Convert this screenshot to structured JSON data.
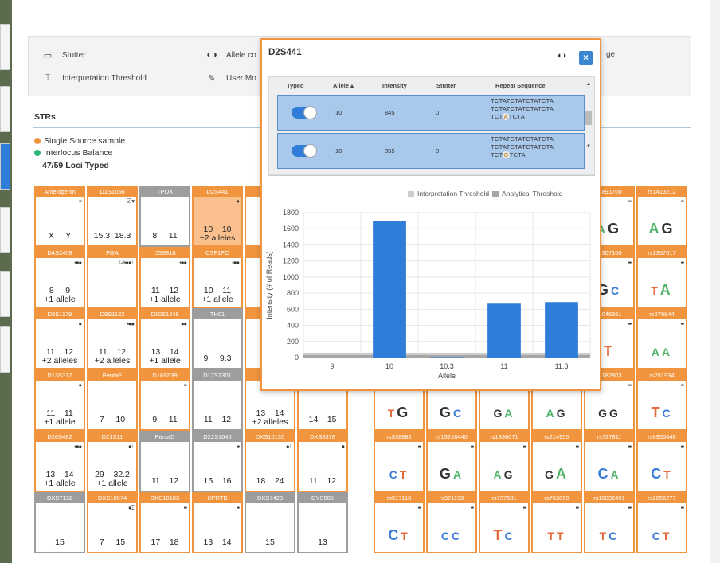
{
  "legend": {
    "stutter": "Stutter",
    "allele_cov_partial": "Allele co",
    "interp_threshold": "Interpretation Threshold",
    "user_mod_partial": "User Mo",
    "right_partial": "ge",
    "icons": {
      "stutter": "stutter-icon",
      "allele": "allele-coverage-icon",
      "threshold": "threshold-icon",
      "user": "user-modified-icon"
    }
  },
  "strs": {
    "title": "STRs",
    "single_source": "Single Source sample",
    "interlocus": "Interlocus Balance",
    "loci_typed": "47/59 Loci Typed",
    "colors": {
      "single_source": "#f0953e",
      "interlocus": "#2bb673"
    }
  },
  "cells": [
    {
      "name": "Amelogenin",
      "v": "X     Y",
      "ic": "•▪",
      "g": false
    },
    {
      "name": "D1S1656",
      "v": "15.3  18.3",
      "ic": "☑ ▾",
      "g": false
    },
    {
      "name": "TPOX",
      "v": "8     11",
      "ic": "",
      "g": true
    },
    {
      "name": "D2S441",
      "v": "10    10\n+2 alleles",
      "ic": "●",
      "g": false,
      "sel": true
    },
    {
      "name": "D4S2408",
      "v": "8     9\n+1 allele",
      "ic": "▪●●",
      "g": false
    },
    {
      "name": "FGA",
      "v": "",
      "ic": "☑▪●●⌶",
      "g": false
    },
    {
      "name": "D5S818",
      "v": "11    12\n+1 allele",
      "ic": "▪●●",
      "g": false
    },
    {
      "name": "CSF1PO",
      "v": "10    11\n+1 allele",
      "ic": "▪●●",
      "g": false
    },
    {
      "name": "D8S1179",
      "v": "11    12\n+2 alleles",
      "ic": "●",
      "g": false
    },
    {
      "name": "D9S1122",
      "v": "11    12\n+2 alleles",
      "ic": "▪●●",
      "g": false
    },
    {
      "name": "D10S1248",
      "v": "13    14\n+1 allele",
      "ic": "●●",
      "g": false
    },
    {
      "name": "TH01",
      "v": "9     9.3",
      "ic": "",
      "g": true
    },
    {
      "name": "D13S317",
      "v": "11    11\n+1 allele",
      "ic": "●",
      "g": false
    },
    {
      "name": "PentaE",
      "v": "7     10",
      "ic": "",
      "g": false
    },
    {
      "name": "D16S539",
      "v": "9     11",
      "ic": "▪▪",
      "g": false
    },
    {
      "name": "D17S1301",
      "v": "11    12",
      "ic": "",
      "g": true
    },
    {
      "name": "D20S482",
      "v": "13    14\n+1 allele",
      "ic": "▪●●",
      "g": false
    },
    {
      "name": "D21S11",
      "v": "29    32.2\n+1 allele",
      "ic": "●⌶",
      "g": false
    },
    {
      "name": "PentaD",
      "v": "11    12",
      "ic": "",
      "g": true
    },
    {
      "name": "D22S1045",
      "v": "15    16",
      "ic": "▪▪",
      "g": true
    },
    {
      "name": "DXS7132",
      "v": "15",
      "ic": "",
      "g": true
    },
    {
      "name": "DXS10074",
      "v": "7     15",
      "ic": "●⌶",
      "g": false
    },
    {
      "name": "DXS10103",
      "v": "17    18",
      "ic": "▪▪",
      "g": false
    },
    {
      "name": "HPRTB",
      "v": "13    14",
      "ic": "▪▪",
      "g": false
    }
  ],
  "cells_col5": [
    {
      "name": "D",
      "v": "10\n+2",
      "ic": "",
      "g": false
    },
    {
      "name": "D",
      "v": "1",
      "ic": "",
      "g": false
    },
    {
      "name": "",
      "v": "1\n+",
      "ic": "▪●",
      "g": false
    },
    {
      "name": "D",
      "v": "13    14\n+2 alleles",
      "ic": "",
      "g": false
    },
    {
      "name": "DXS10135",
      "v": "18    24",
      "ic": "●⌶",
      "g": false
    },
    {
      "name": "DXS7423",
      "v": "15",
      "ic": "",
      "g": true
    }
  ],
  "cells_col6": [
    {
      "name": "",
      "v": "14    15",
      "ic": "",
      "g": false
    },
    {
      "name": "DXS8378",
      "v": "11    12",
      "ic": "●",
      "g": false
    },
    {
      "name": "DYS505",
      "v": "13",
      "ic": "",
      "g": true
    }
  ],
  "snps": {
    "row0": [
      {
        "name": "rs891700",
        "bases": [
          [
            "A",
            "sm"
          ],
          [
            "G",
            ""
          ]
        ],
        "partial": true
      },
      {
        "name": "rs1413212",
        "bases": [
          [
            "A",
            ""
          ],
          [
            "G",
            ""
          ]
        ]
      }
    ],
    "row1": [
      {
        "name": "rs907100",
        "bases": [
          [
            "G",
            ""
          ],
          [
            "C",
            "sm"
          ]
        ],
        "partial": true
      },
      {
        "name": "rs1357617",
        "bases": [
          [
            "T",
            "sm"
          ],
          [
            "A",
            ""
          ]
        ]
      }
    ],
    "row2": [
      {
        "name": "rs046361",
        "bases": [
          [
            "T",
            ""
          ]
        ],
        "partial": true
      },
      {
        "name": "rs279844",
        "bases": [
          [
            "A",
            "sm"
          ],
          [
            "A",
            "sm"
          ]
        ]
      }
    ],
    "row3": [
      {
        "name": "",
        "bases": [
          [
            "T",
            "sm"
          ],
          [
            "G",
            ""
          ]
        ]
      },
      {
        "name": "",
        "bases": [
          [
            "G",
            ""
          ],
          [
            "C",
            "sm"
          ]
        ]
      },
      {
        "name": "",
        "bases": [
          [
            "G",
            "sm"
          ],
          [
            "A",
            "sm"
          ]
        ]
      },
      {
        "name": "",
        "bases": [
          [
            "A",
            "sm"
          ],
          [
            "G",
            "sm"
          ]
        ]
      },
      {
        "name": "rs182803",
        "bases": [
          [
            "G",
            "sm"
          ],
          [
            "G",
            "sm"
          ]
        ]
      },
      {
        "name": "rs251934",
        "bases": [
          [
            "T",
            ""
          ],
          [
            "C",
            "sm"
          ]
        ]
      }
    ],
    "row4": [
      {
        "name": "rs338882",
        "bases": [
          [
            "C",
            "sm"
          ],
          [
            "T",
            "sm"
          ]
        ]
      },
      {
        "name": "rs13218440",
        "bases": [
          [
            "G",
            ""
          ],
          [
            "A",
            "sm"
          ]
        ]
      },
      {
        "name": "rs1336071",
        "bases": [
          [
            "A",
            "sm"
          ],
          [
            "G",
            "sm"
          ]
        ]
      },
      {
        "name": "rs214955",
        "bases": [
          [
            "G",
            "sm"
          ],
          [
            "A",
            ""
          ]
        ]
      },
      {
        "name": "rs727811",
        "bases": [
          [
            "C",
            ""
          ],
          [
            "A",
            "sm"
          ]
        ]
      },
      {
        "name": "rs6955448",
        "bases": [
          [
            "C",
            ""
          ],
          [
            "T",
            "sm"
          ]
        ]
      }
    ],
    "row5": [
      {
        "name": "rs917118",
        "bases": [
          [
            "C",
            ""
          ],
          [
            "T",
            "sm"
          ]
        ]
      },
      {
        "name": "rs321198",
        "bases": [
          [
            "C",
            "sm"
          ],
          [
            "C",
            "sm"
          ]
        ]
      },
      {
        "name": "rs737681",
        "bases": [
          [
            "T",
            ""
          ],
          [
            "C",
            "sm"
          ]
        ]
      },
      {
        "name": "rs763869",
        "bases": [
          [
            "T",
            "sm"
          ],
          [
            "T",
            "sm"
          ]
        ]
      },
      {
        "name": "rs10092491",
        "bases": [
          [
            "T",
            "sm"
          ],
          [
            "C",
            "sm"
          ]
        ]
      },
      {
        "name": "rs2056277",
        "bases": [
          [
            "C",
            "sm"
          ],
          [
            "T",
            "sm"
          ]
        ]
      }
    ]
  },
  "popup": {
    "title": "D2S441",
    "close": "×",
    "headers": {
      "typed": "Typed",
      "allele": "Allele ▴",
      "intensity": "Intensity",
      "stutter": "Stutter",
      "repeat": "Repeat Sequence"
    },
    "rows": [
      {
        "allele": "10",
        "intensity": "845",
        "stutter": "0",
        "seq1": "TCTATCTATCTATCTA",
        "seq2": "TCTATCTATCTATCTA",
        "seq3a": "TCT",
        "seq3m": "A",
        "seq3b": "TCTA"
      },
      {
        "allele": "10",
        "intensity": "855",
        "stutter": "0",
        "seq1": "TCTATCTATCTATCTA",
        "seq2": "TCTATCTATCTATCTA",
        "seq3a": "TCT",
        "seq3m": "G",
        "seq3b": "TCTA"
      }
    ],
    "chart_legend": {
      "interp": "Interpretation Threshold",
      "analytical": "Analytical Threshold"
    }
  },
  "chart_data": {
    "type": "bar",
    "categories": [
      "9",
      "10",
      "10.3",
      "11",
      "11.3"
    ],
    "values": [
      0,
      1700,
      5,
      670,
      690
    ],
    "xlabel": "Allele",
    "ylabel": "Intensity (# of Reads)",
    "ylim": [
      0,
      1800
    ],
    "yticks": [
      0,
      200,
      400,
      600,
      800,
      1000,
      1200,
      1400,
      1600,
      1800
    ],
    "grid": true,
    "legend": "top-right",
    "threshold_bands": {
      "interpretation": 60,
      "analytical": 30
    },
    "colors": {
      "bar": "#2f7dd8",
      "interp": "#cccccc",
      "analytical": "#a6a6a6"
    }
  }
}
